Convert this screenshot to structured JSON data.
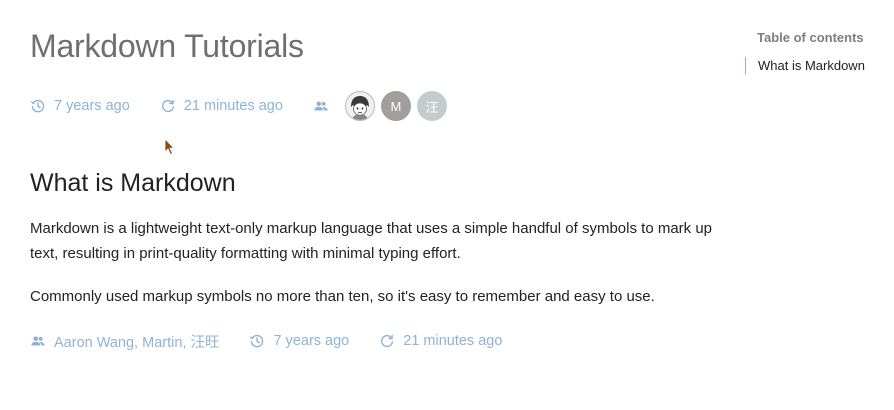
{
  "page": {
    "title": "Markdown Tutorials"
  },
  "meta_top": {
    "created": "7 years ago",
    "updated": "21 minutes ago",
    "created_icon": "history-icon",
    "updated_icon": "refresh-icon",
    "contributors_icon": "people-icon",
    "avatars": [
      {
        "type": "image",
        "name": "avatar-illustration"
      },
      {
        "type": "initial",
        "letter": "M",
        "color": "#a29e9c"
      },
      {
        "type": "initial",
        "letter": "汪",
        "color": "#c5cbcd"
      }
    ]
  },
  "content": {
    "heading": "What is Markdown",
    "paragraphs": [
      "Markdown is a lightweight text-only markup language that uses a simple handful of symbols to mark up text, resulting in print-quality formatting with minimal typing effort.",
      "Commonly used markup symbols no more than ten, so it's easy to remember and easy to use."
    ]
  },
  "meta_bottom": {
    "authors": "Aaron Wang, Martin, 汪旺",
    "created": "7 years ago",
    "updated": "21 minutes ago"
  },
  "toc": {
    "title": "Table of contents",
    "items": [
      {
        "label": "What is Markdown"
      }
    ]
  },
  "colors": {
    "accent": "#8fb3d4",
    "title_gray": "#6f6f6f",
    "text": "#222222"
  }
}
